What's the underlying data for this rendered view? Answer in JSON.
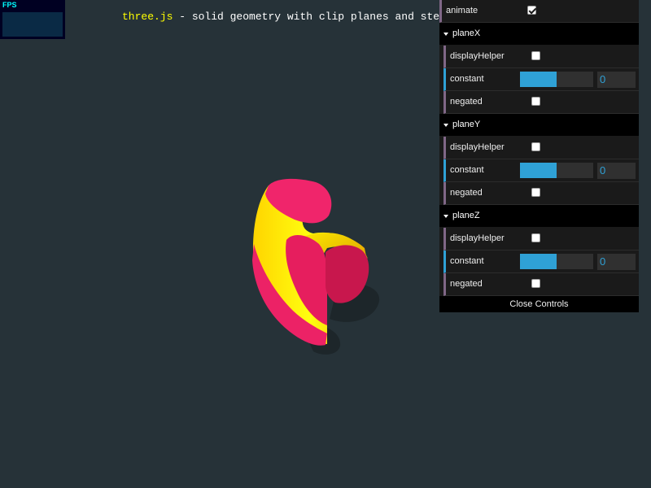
{
  "stats": {
    "fps_label": "FPS"
  },
  "info": {
    "link_text": "three.js",
    "rest_text": " - solid geometry with clip planes and ste"
  },
  "gui": {
    "animate": {
      "label": "animate",
      "checked": true
    },
    "folders": [
      {
        "name": "planeX",
        "displayHelper": {
          "label": "displayHelper",
          "checked": false
        },
        "constant": {
          "label": "constant",
          "value": "0",
          "fraction": 0.5
        },
        "negated": {
          "label": "negated",
          "checked": false
        }
      },
      {
        "name": "planeY",
        "displayHelper": {
          "label": "displayHelper",
          "checked": false
        },
        "constant": {
          "label": "constant",
          "value": "0",
          "fraction": 0.5
        },
        "negated": {
          "label": "negated",
          "checked": false
        }
      },
      {
        "name": "planeZ",
        "displayHelper": {
          "label": "displayHelper",
          "checked": false
        },
        "constant": {
          "label": "constant",
          "value": "0",
          "fraction": 0.5
        },
        "negated": {
          "label": "negated",
          "checked": false
        }
      }
    ],
    "close_label": "Close Controls"
  },
  "colors": {
    "background": "#263238",
    "solid_yellow": "#ffcc00",
    "cap_pink": "#e91e63",
    "slider_blue": "#2fa1d6"
  }
}
